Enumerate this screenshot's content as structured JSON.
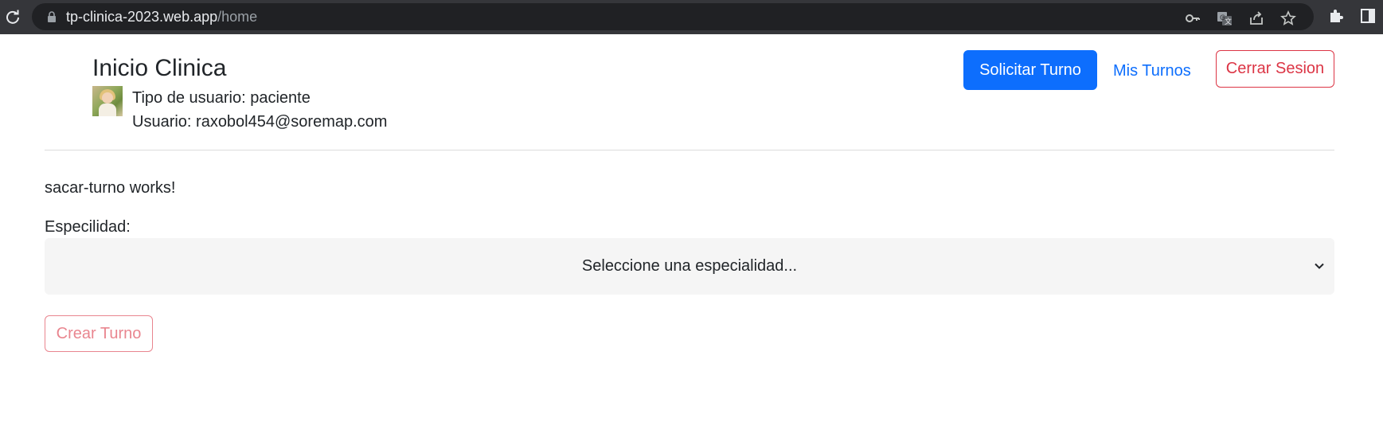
{
  "browser": {
    "url_host": "tp-clinica-2023.web.app",
    "url_path": "/home",
    "icons": [
      "reload-icon",
      "lock-icon",
      "key-icon",
      "translate-icon",
      "share-icon",
      "star-icon",
      "extensions-icon",
      "sidepanel-icon"
    ]
  },
  "header": {
    "title": "Inicio Clinica",
    "user_type": "Tipo de usuario: paciente",
    "user_email": "Usuario: raxobol454@soremap.com",
    "nav": {
      "solicitar_label": "Solicitar Turno",
      "mis_turnos_label": "Mis Turnos",
      "cerrar_label": "Cerrar Sesion"
    }
  },
  "main": {
    "status_text": "sacar-turno works!",
    "especialidad_label": "Especilidad:",
    "especialidad_selected": "Seleccione una especialidad...",
    "crear_label": "Crear Turno"
  },
  "colors": {
    "primary": "#0d6efd",
    "danger": "#dc3545",
    "chrome_bar": "#35363a",
    "omnibox": "#202124"
  }
}
